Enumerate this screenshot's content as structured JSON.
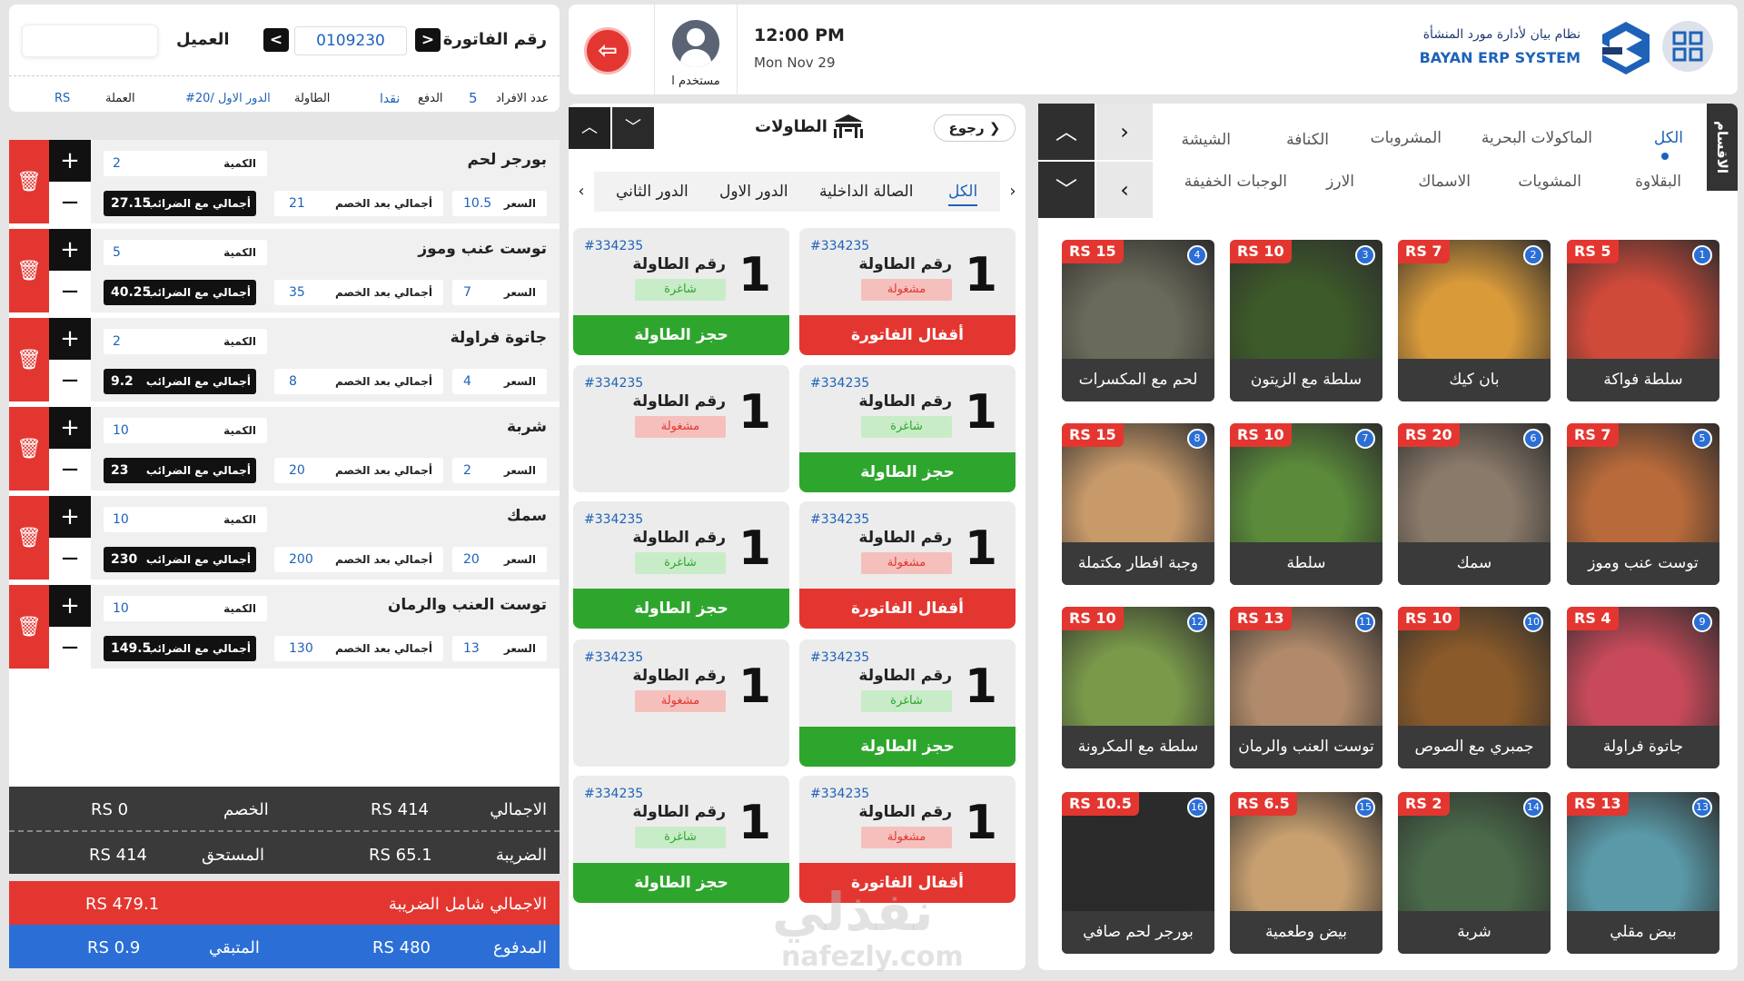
{
  "header": {
    "logo_ar": "نظام بيان لأدارة مورد المنشأة",
    "logo_en": "BAYAN ERP SYSTEM",
    "time": "12:00 PM",
    "date": "Mon Nov 29",
    "user": "مستخدم ا"
  },
  "invoice": {
    "number_label": "رقم الفاتورة",
    "number": "0109230",
    "customer_label": "العميل",
    "customer_value": "",
    "persons_label": "عدد الافراد",
    "persons": "5",
    "payment_label": "الدفع",
    "payment": "نقدا",
    "table_label": "الطاولة",
    "table": "#20/ الدور الاول",
    "currency_label": "العملة",
    "currency": "RS"
  },
  "items": [
    {
      "name": "بورجر لحم",
      "qty_label": "الكمية",
      "qty": "2",
      "price_label": "السعر",
      "price": "10.5",
      "after_label": "أجمالي بعد الخصم",
      "after": "21",
      "total_label": "أجمالي مع الضرائب",
      "total": "27.15"
    },
    {
      "name": "توست عنب وموز",
      "qty_label": "الكمية",
      "qty": "5",
      "price_label": "السعر",
      "price": "7",
      "after_label": "أجمالي بعد الخصم",
      "after": "35",
      "total_label": "أجمالي مع الضرائب",
      "total": "40.25"
    },
    {
      "name": "جاتوة فراولة",
      "qty_label": "الكمية",
      "qty": "2",
      "price_label": "السعر",
      "price": "4",
      "after_label": "أجمالي بعد الخصم",
      "after": "8",
      "total_label": "أجمالي مع الضرائب",
      "total": "9.2"
    },
    {
      "name": "شربة",
      "qty_label": "الكمية",
      "qty": "10",
      "price_label": "السعر",
      "price": "2",
      "after_label": "أجمالي بعد الخصم",
      "after": "20",
      "total_label": "أجمالي مع الضرائب",
      "total": "23"
    },
    {
      "name": "سمك",
      "qty_label": "الكمية",
      "qty": "10",
      "price_label": "السعر",
      "price": "20",
      "after_label": "أجمالي بعد الخصم",
      "after": "200",
      "total_label": "أجمالي مع الضرائب",
      "total": "230"
    },
    {
      "name": "توست العنب والرمان",
      "qty_label": "الكمية",
      "qty": "10",
      "price_label": "السعر",
      "price": "13",
      "after_label": "أجمالي بعد الخصم",
      "after": "130",
      "total_label": "أجمالي مع الضرائب",
      "total": "149.5"
    }
  ],
  "totals": {
    "total_label": "الاجمالي",
    "total": "RS 414",
    "discount_label": "الخصم",
    "discount": "RS  0",
    "tax_label": "الضريبة",
    "tax": "RS 65.1",
    "due_label": "المستحق",
    "due": "RS 414",
    "grand_label": "الاجمالي شامل الضريبة",
    "grand": "RS 479.1",
    "paid_label": "المدفوع",
    "paid": "RS 480",
    "rest_label": "المتبقي",
    "rest": "RS 0.9"
  },
  "tables": {
    "title": "الطاولات",
    "back": "رجوع",
    "tabs": [
      "الكل",
      "الصالة الداخلية",
      "الدور الاول",
      "الدور الثاني"
    ],
    "table_label": "رقم الطاولة",
    "cards": [
      {
        "code": "#334235",
        "num": "1",
        "status": "مشغولة",
        "action": "أقفال الفاتورة"
      },
      {
        "code": "#334235",
        "num": "1",
        "status": "شاغرة",
        "action": "حجز الطاولة"
      },
      {
        "code": "#334235",
        "num": "1",
        "status": "شاغرة",
        "action": "حجز الطاولة"
      },
      {
        "code": "#334235",
        "num": "1",
        "status": "مشغولة",
        "action": ""
      },
      {
        "code": "#334235",
        "num": "1",
        "status": "مشغولة",
        "action": "أقفال الفاتورة"
      },
      {
        "code": "#334235",
        "num": "1",
        "status": "شاغرة",
        "action": "حجز الطاولة"
      },
      {
        "code": "#334235",
        "num": "1",
        "status": "شاغرة",
        "action": "حجز الطاولة"
      },
      {
        "code": "#334235",
        "num": "1",
        "status": "مشغولة",
        "action": ""
      },
      {
        "code": "#334235",
        "num": "1",
        "status": "مشغولة",
        "action": "أقفال الفاتورة"
      },
      {
        "code": "#334235",
        "num": "1",
        "status": "شاغرة",
        "action": "حجز الطاولة"
      }
    ]
  },
  "menu": {
    "side_label": "الاقسام",
    "categories_row1": [
      "الكل",
      "الماكولات البحرية",
      "المشروبات",
      "الكنافة",
      "الشيشة"
    ],
    "categories_row2": [
      "البقلاوة",
      "المشويات",
      "الاسماك",
      "الارز",
      "الوجبات الخفيفة"
    ],
    "products": [
      {
        "idx": "1",
        "price": "RS 5",
        "name": "سلطة فواكة",
        "color": "#d04a3a"
      },
      {
        "idx": "2",
        "price": "RS 7",
        "name": "بان كيك",
        "color": "#d99a3a"
      },
      {
        "idx": "3",
        "price": "RS 10",
        "name": "سلطة مع الزيتون",
        "color": "#3d5a2a"
      },
      {
        "idx": "4",
        "price": "RS 15",
        "name": "لحم مع المكسرات",
        "color": "#6a6a5a"
      },
      {
        "idx": "5",
        "price": "RS 7",
        "name": "توست عنب وموز",
        "color": "#b86a3a"
      },
      {
        "idx": "6",
        "price": "RS 20",
        "name": "سمك",
        "color": "#8a7a6a"
      },
      {
        "idx": "7",
        "price": "RS 10",
        "name": "سلطة",
        "color": "#5a8a3a"
      },
      {
        "idx": "8",
        "price": "RS 15",
        "name": "وجبة افطار مكتملة",
        "color": "#c89a6a"
      },
      {
        "idx": "9",
        "price": "RS 4",
        "name": "جاتوة فراولة",
        "color": "#c84a5a"
      },
      {
        "idx": "10",
        "price": "RS 10",
        "name": "جمبري مع الصوص",
        "color": "#8a5a2a"
      },
      {
        "idx": "11",
        "price": "RS 13",
        "name": "توست العنب والرمان",
        "color": "#b08a6a"
      },
      {
        "idx": "12",
        "price": "RS 10",
        "name": "سلطة مع المكرونة",
        "color": "#7a9a4a"
      },
      {
        "idx": "13",
        "price": "RS 13",
        "name": "بيض مقلي",
        "color": "#5a9aa8"
      },
      {
        "idx": "14",
        "price": "RS 2",
        "name": "شربة",
        "color": "#4a6a4a"
      },
      {
        "idx": "15",
        "price": "RS 6.5",
        "name": "بيض وطعمية",
        "color": "#c8a070"
      },
      {
        "idx": "16",
        "price": "RS 10.5",
        "name": "بورجر لحم صافي",
        "color": "#2a2a2a"
      }
    ]
  },
  "watermark": {
    "main": "نفذلي",
    "sub": "nafezly.com"
  },
  "colors": {
    "red": "#e43630",
    "green": "#2ea62d",
    "blue": "#2b6fd6",
    "dark": "#3a3a3a"
  }
}
